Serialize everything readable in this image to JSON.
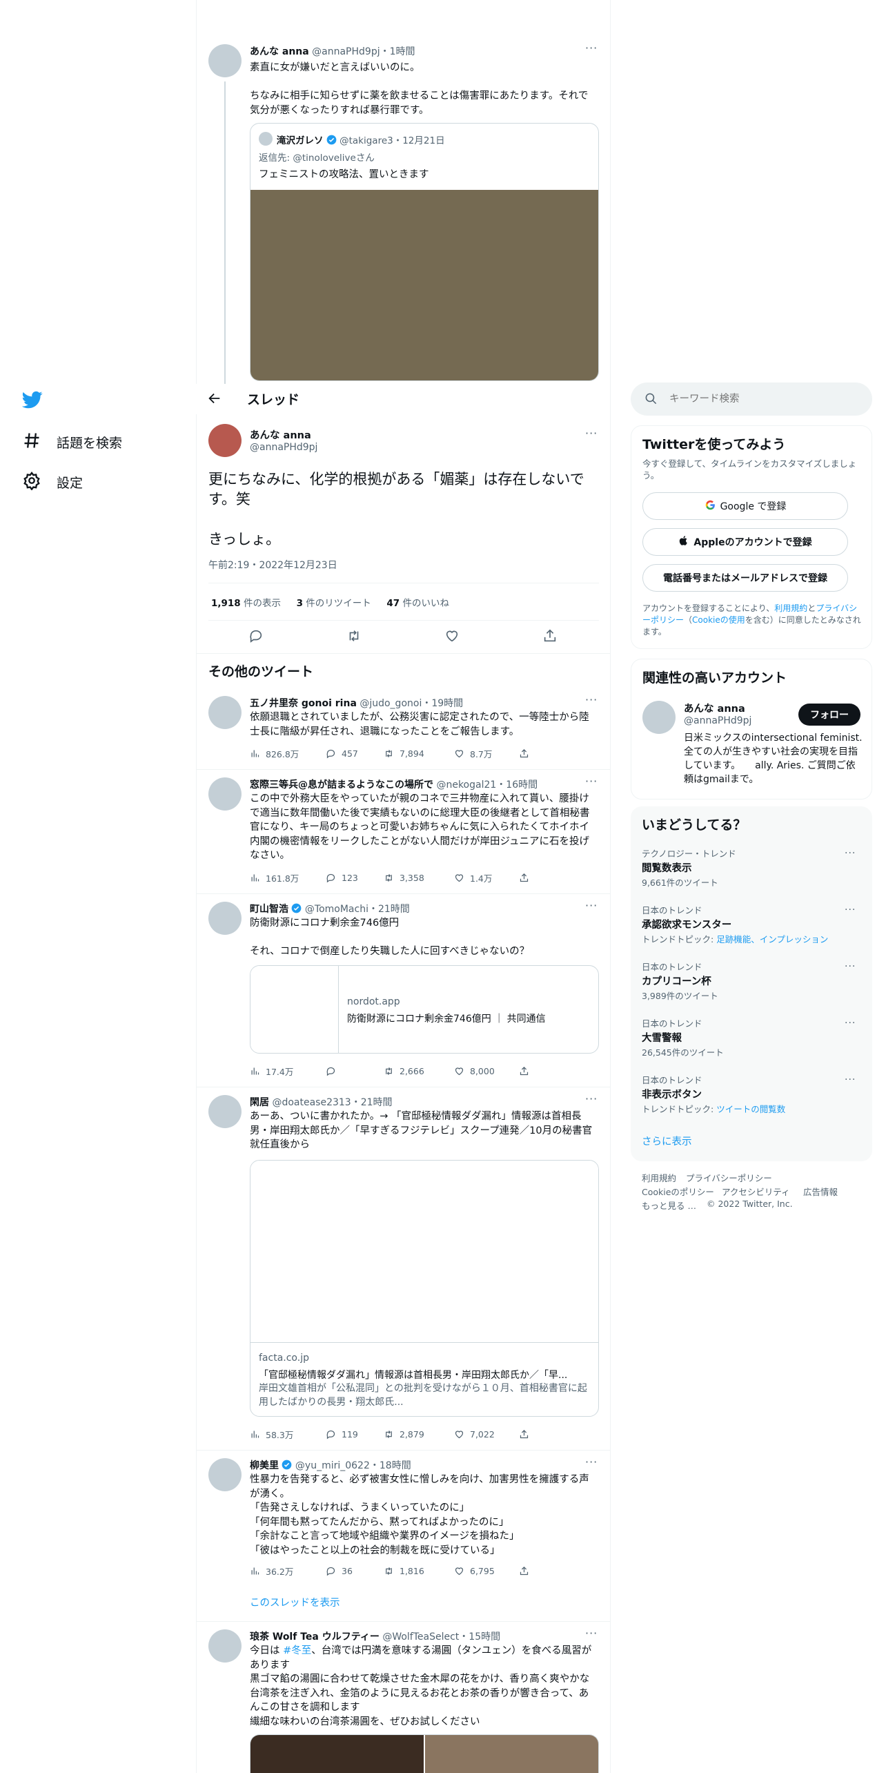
{
  "nav": {
    "items": [
      {
        "label": "話題を検索",
        "icon": "hashtag-icon"
      },
      {
        "label": "設定",
        "icon": "gear-icon"
      }
    ]
  },
  "header": {
    "title": "スレッド"
  },
  "context_tweet": {
    "name": "あんな anna",
    "handle": "@annaPHd9pj",
    "time": "1時間",
    "text": "素直に女が嫌いだと言えばいいのに。\n\nちなみに相手に知らせずに薬を飲ませることは傷害罪にあたります。それで気分が悪くなったりすれば暴行罪です。",
    "quote": {
      "name": "滝沢ガレソ",
      "handle": "@takigare3",
      "time": "12月21日",
      "reply_to_prefix": "返信先: ",
      "reply_to_handle": "@tinolovelive",
      "reply_to_suffix": "さん",
      "text": "フェミニストの攻略法、置いときます"
    }
  },
  "main_tweet": {
    "name": "あんな anna",
    "handle": "@annaPHd9pj",
    "text": "更にちなみに、化学的根拠がある「媚薬」は存在しないです。笑\n\nきっしょ。",
    "timestamp": "午前2:19・2022年12月23日",
    "views_count": "1,918",
    "views_label": " 件の表示",
    "retweets_count": "3",
    "retweets_label": " 件のリツイート",
    "likes_count": "47",
    "likes_label": " 件のいいね"
  },
  "more_tweets": {
    "heading": "その他のツイート",
    "tweets": [
      {
        "name": "五ノ井里奈 gonoi rina",
        "handle": "@judo_gonoi",
        "time": "19時間",
        "text": "依願退職とされていましたが、公務災害に認定されたので、一等陸士から陸士長に階級が昇任され、退職になったことをご報告します。",
        "views": "826.8万",
        "replies": "457",
        "retweets": "7,894",
        "likes": "8.7万"
      },
      {
        "name": "窓際三等兵@息が詰まるようなこの場所で",
        "handle": "@nekogal21",
        "time": "16時間",
        "text": "この中で外務大臣をやっていたが親のコネで三井物産に入れて貰い、腰掛けで適当に数年間働いた後で実績もないのに総理大臣の後継者として首相秘書官になり、キー局のちょっと可愛いお姉ちゃんに気に入られたくてホイホイ内閣の機密情報をリークしたことがない人間だけが岸田ジュニアに石を投げなさい。",
        "views": "161.8万",
        "replies": "123",
        "retweets": "3,358",
        "likes": "1.4万"
      },
      {
        "name": "町山智浩",
        "handle": "@TomoMachi",
        "time": "21時間",
        "text": "防衛財源にコロナ剰余金746億円\n\nそれ、コロナで倒産したり失職した人に回すべきじゃないの？",
        "card_domain": "nordot.app",
        "card_title": "防衛財源にコロナ剰余金746億円 ｜ 共同通信",
        "views": "17.4万",
        "replies": "",
        "retweets": "2,666",
        "likes": "8,000"
      },
      {
        "name": "閑居",
        "handle": "@doatease2313",
        "time": "21時間",
        "text": "あーあ、ついに書かれたか。→ 「官邸極秘情報ダダ漏れ」情報源は首相長男・岸田翔太郎氏か／「早すぎるフジテレビ」スクープ連発／10月の秘書官就任直後から",
        "card_domain": "facta.co.jp",
        "card_title": "「官邸極秘情報ダダ漏れ」情報源は首相長男・岸田翔太郎氏か／「早...",
        "card_desc": "岸田文雄首相が「公私混同」との批判を受けながら１０月、首相秘書官に起用したばかりの長男・翔太郎氏...",
        "views": "58.3万",
        "replies": "119",
        "retweets": "2,879",
        "likes": "7,022"
      },
      {
        "name": "柳美里",
        "handle": "@yu_miri_0622",
        "time": "18時間",
        "text": "性暴力を告発すると、必ず被害女性に憎しみを向け、加害男性を擁護する声が湧く。\n「告発さえしなければ、うまくいっていたのに」\n「何年間も黙ってたんだから、黙ってればよかったのに」\n「余計なこと言って地域や組織や業界のイメージを損ねた」\n「彼はやったこと以上の社会的制裁を既に受けている」",
        "views": "36.2万",
        "replies": "36",
        "retweets": "1,816",
        "likes": "6,795",
        "show_thread": "このスレッドを表示"
      },
      {
        "name": "琅茶 Wolf Tea ウルフティー",
        "handle": "@WolfTeaSelect",
        "time": "15時間",
        "text_pre": "今日は ",
        "hashtag": "#冬至",
        "text": "、台湾では円満を意味する湯圓（タンユェン）を食べる風習があります\n黒ゴマ餡の湯圓に合わせて乾燥させた金木犀の花をかけ、香り高く爽やかな台湾茶を注ぎ入れ、金箔のように見えるお花とお茶の香りが響き合って、あんこの甘さを調和します\n繊細な味わいの台湾茶湯圓を、ぜひお試しください"
      }
    ]
  },
  "search": {
    "placeholder": "キーワード検索"
  },
  "signup": {
    "title": "Twitterを使ってみよう",
    "subtitle": "今すぐ登録して、タイムラインをカスタマイズしましょう。",
    "google": "Google で登録",
    "apple": "Appleのアカウントで登録",
    "phone": "電話番号またはメールアドレスで登録",
    "legal_1": "アカウントを登録することにより、",
    "legal_terms": "利用規約",
    "legal_2": "と",
    "legal_privacy": "プライバシーポリシー",
    "legal_3": "（",
    "legal_cookie": "Cookieの使用",
    "legal_4": "を含む）に同意したとみなされます。"
  },
  "relevant": {
    "title": "関連性の高いアカウント",
    "name": "あんな anna",
    "handle": "@annaPHd9pj",
    "follow": "フォロー",
    "bio": "日米ミックスのintersectional feminist. 全ての人が生きやすい社会の実現を目指しています。　　ally. Aries. ご質問ご依頼はgmailまで。"
  },
  "trends": {
    "title": "いまどうしてる？",
    "items": [
      {
        "meta": "テクノロジー・トレンド",
        "name": "閲覧数表示",
        "sub": "9,661件のツイート"
      },
      {
        "meta": "日本のトレンド",
        "name": "承認欲求モンスター",
        "sub_prefix": "トレンドトピック: ",
        "sub_link": "足跡機能、インプレッション"
      },
      {
        "meta": "日本のトレンド",
        "name": "カプリコーン杯",
        "sub": "3,989件のツイート"
      },
      {
        "meta": "日本のトレンド",
        "name": "大雪警報",
        "sub": "26,545件のツイート"
      },
      {
        "meta": "日本のトレンド",
        "name": "非表示ボタン",
        "sub_prefix": "トレンドトピック: ",
        "sub_link": "ツイートの閲覧数"
      }
    ],
    "show_more": "さらに表示"
  },
  "footer": {
    "links": [
      "利用規約",
      "プライバシーポリシー",
      "Cookieのポリシー",
      "アクセシビリティ",
      "広告情報",
      "もっと見る …"
    ],
    "copyright": "© 2022 Twitter, Inc."
  },
  "colors": {
    "accent": "#1d9bf0",
    "text": "#0f1419",
    "muted": "#536471",
    "border": "#eff3f4"
  }
}
